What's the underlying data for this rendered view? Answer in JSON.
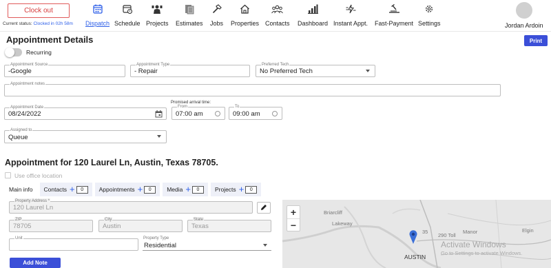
{
  "header": {
    "clock_out_label": "Clock out",
    "status_prefix": "Current status:",
    "status_value": "Clocked in 02h 58m",
    "nav": [
      {
        "label": "Dispatch",
        "icon": "calendar-icon",
        "active": true
      },
      {
        "label": "Schedule",
        "icon": "schedule-icon"
      },
      {
        "label": "Projects",
        "icon": "projects-icon"
      },
      {
        "label": "Estimates",
        "icon": "estimates-icon"
      },
      {
        "label": "Jobs",
        "icon": "hammer-icon"
      },
      {
        "label": "Properties",
        "icon": "home-icon"
      },
      {
        "label": "Contacts",
        "icon": "contacts-icon"
      },
      {
        "label": "Dashboard",
        "icon": "dashboard-icon"
      },
      {
        "label": "Instant Appt.",
        "icon": "instant-appt-icon"
      },
      {
        "label": "Fast-Payment",
        "icon": "fast-payment-icon"
      },
      {
        "label": "Settings",
        "icon": "gear-icon"
      }
    ],
    "user_name": "Jordan Ardoin"
  },
  "page": {
    "title": "Appointment Details",
    "print_label": "Print",
    "recurring_label": "Recurring",
    "recurring_on": false
  },
  "form": {
    "source": {
      "label": "Appointment Source",
      "value": "-Google"
    },
    "type": {
      "label": "Appointment Type",
      "value": "- Repair"
    },
    "tech": {
      "label": "Preferred Tech",
      "value": "No Preferred Tech"
    },
    "notes": {
      "label": "Appointment notes",
      "value": ""
    },
    "date": {
      "label": "Appointment Date",
      "value": "08/24/2022"
    },
    "promised_label": "Promised arrival time:",
    "from": {
      "label": "From",
      "value": "07:00 am"
    },
    "to": {
      "label": "To",
      "value": "09:00 am"
    },
    "assigned": {
      "label": "Assigned to",
      "value": "Queue"
    }
  },
  "location": {
    "heading": "Appointment for 120 Laurel Ln, Austin, Texas 78705.",
    "use_office_label": "Use office location",
    "tabs": [
      {
        "label": "Main info",
        "active": true
      },
      {
        "label": "Contacts",
        "count": "0"
      },
      {
        "label": "Appointments",
        "count": "0"
      },
      {
        "label": "Media",
        "count": "0"
      },
      {
        "label": "Projects",
        "count": "0"
      }
    ],
    "address": {
      "label": "Property Address *",
      "value": "120 Laurel Ln"
    },
    "zip": {
      "label": "ZIP",
      "value": "78705"
    },
    "city": {
      "label": "City",
      "value": "Austin"
    },
    "state": {
      "label": "State",
      "value": "Texas"
    },
    "unit": {
      "label": "Unit",
      "value": ""
    },
    "property_type": {
      "label": "Property Type",
      "value": "Residential"
    },
    "add_note_label": "Add Note"
  },
  "map": {
    "zoom_in": "+",
    "zoom_out": "−",
    "labels": {
      "briarcliff": "Briarcliff",
      "lakeway": "Lakeway",
      "highway_35": "35",
      "toll_290": "290 Toll",
      "manor": "Manor",
      "elgin": "Elgin",
      "austin": "AUSTIN"
    },
    "pin_color": "#3b6fd8"
  },
  "watermark": {
    "line1": "Activate Windows",
    "line2": "Go to Settings to activate Windows."
  },
  "colors": {
    "accent": "#2c5ee8",
    "primary_button": "#3b4fd8",
    "danger": "#d63b3b"
  }
}
